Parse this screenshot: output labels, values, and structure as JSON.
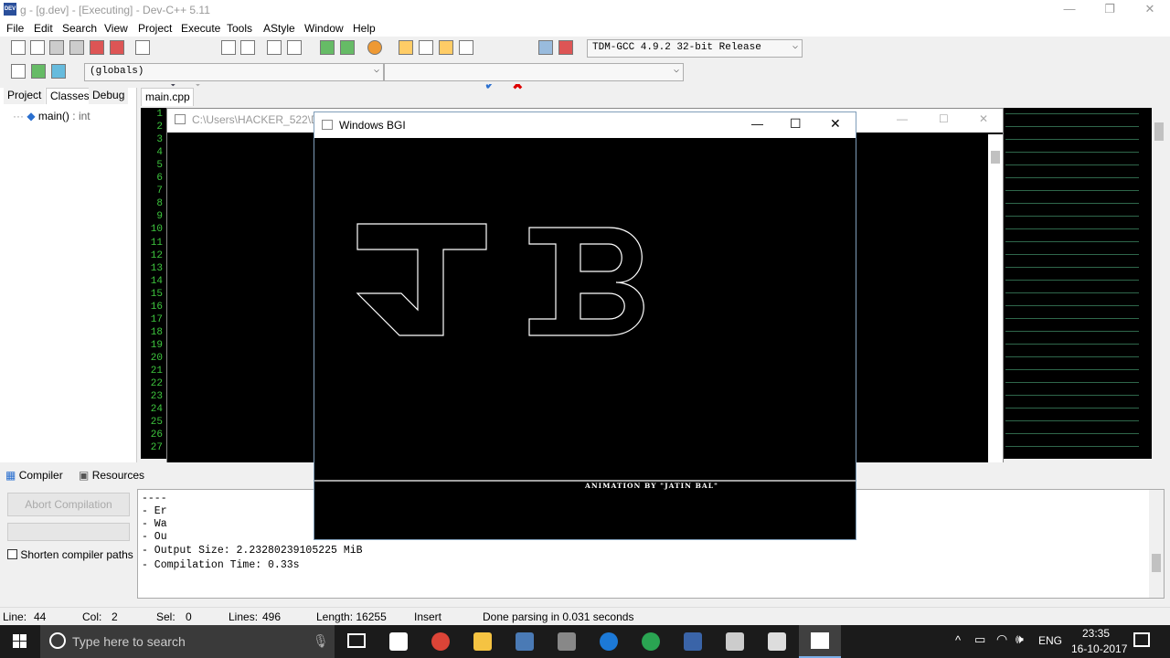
{
  "window": {
    "title": "g - [g.dev] - [Executing] - Dev-C++ 5.11",
    "app_icon_text": "DEV"
  },
  "menu": [
    "File",
    "Edit",
    "Search",
    "View",
    "Project",
    "Execute",
    "Tools",
    "AStyle",
    "Window",
    "Help"
  ],
  "toolbar": {
    "compiler_select": "TDM-GCC 4.9.2 32-bit Release",
    "scope_select": "(globals)",
    "symbol_select": ""
  },
  "left_panel": {
    "tabs": [
      "Project",
      "Classes",
      "Debug"
    ],
    "active_tab": "Classes",
    "class_item": "main()",
    "class_item_type": ": int"
  },
  "editor": {
    "file_tab": "main.cpp",
    "line_numbers": [
      "1",
      "2",
      "3",
      "4",
      "5",
      "6",
      "7",
      "8",
      "9",
      "10",
      "11",
      "12",
      "13",
      "14",
      "15",
      "16",
      "17",
      "18",
      "19",
      "20",
      "21",
      "22",
      "23",
      "24",
      "25",
      "26",
      "27"
    ]
  },
  "console_window": {
    "title": "C:\\Users\\HACKER_522\\Doc"
  },
  "bgi_window": {
    "title": "Windows BGI",
    "caption": "ANIMATION BY \"JATIN BAL\"",
    "letters": "JB"
  },
  "bottom_panel": {
    "tabs": [
      "Compiler",
      "Resources"
    ],
    "abort_button": "Abort Compilation",
    "shorten_label": "Shorten compiler paths",
    "log_lines": [
      "----",
      "- Er",
      "- Wa",
      "- Ou",
      "- Output Size: 2.23280239105225 MiB",
      "- Compilation Time: 0.33s"
    ]
  },
  "statusbar": {
    "line_label": "Line:",
    "line": "44",
    "col_label": "Col:",
    "col": "2",
    "sel_label": "Sel:",
    "sel": "0",
    "lines_label": "Lines:",
    "lines": "496",
    "length_label": "Length: 16255",
    "mode": "Insert",
    "parse": "Done parsing in 0.031 seconds"
  },
  "taskbar": {
    "search_placeholder": "Type here to search",
    "lang": "ENG",
    "time": "23:35",
    "date": "16-10-2017"
  }
}
